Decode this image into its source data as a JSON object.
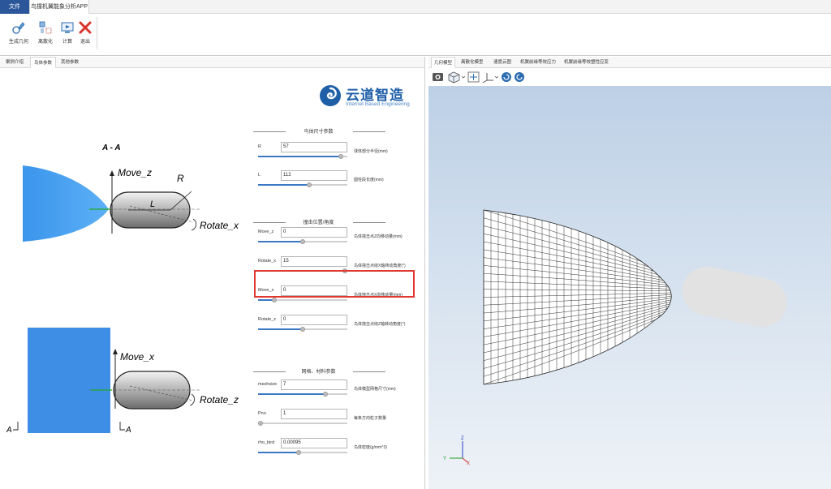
{
  "menu": {
    "file_tab": "文件",
    "app_tab": "鸟撞机翼能象分析APP"
  },
  "ribbon": {
    "buttons": [
      {
        "label": "生成几何",
        "icon": "geometry-icon"
      },
      {
        "label": "离散化",
        "icon": "mesh-icon"
      },
      {
        "label": "计算",
        "icon": "compute-icon"
      },
      {
        "label": "退出",
        "icon": "exit-icon"
      }
    ]
  },
  "left_tabs": [
    "案例介绍",
    "鸟体参数",
    "其他参数"
  ],
  "logo": {
    "brand": "云道智造",
    "sub": "Internet Based Engineering"
  },
  "diagram": {
    "section_title": "A - A",
    "move_z": "Move_z",
    "R": "R",
    "L": "L",
    "rotate_x": "Rotate_x",
    "move_x": "Move_x",
    "rotate_z": "Rotate_z",
    "a_left": "A",
    "a_right": "A"
  },
  "sections": {
    "size": "鸟体尺寸参数",
    "position": "撞击位置/角度",
    "mesh": "网格、材料参数"
  },
  "params": [
    {
      "label": "R",
      "value": "57",
      "desc": "球体部分半径(mm)",
      "fill": 0.93
    },
    {
      "label": "L",
      "value": "112",
      "desc": "圆柱段长度(mm)",
      "fill": 0.57
    },
    {
      "label": "Move_z",
      "value": "0",
      "desc": "鸟体撞击点Z向移动量(mm)",
      "fill": 0.5
    },
    {
      "label": "Rotate_x",
      "value": "15",
      "desc": "鸟体撞击点绕X轴转动角度(°)",
      "fill": 0.97
    },
    {
      "label": "Move_x",
      "value": "0",
      "desc": "鸟体撞击点X向移动量(mm)",
      "fill": 0.18
    },
    {
      "label": "Rotate_z",
      "value": "0",
      "desc": "鸟体撞击点绕Z轴转动角度(°)",
      "fill": 0.5
    },
    {
      "label": "meshsize",
      "value": "7",
      "desc": "鸟体模型网格尺寸(mm)",
      "fill": 0.75
    },
    {
      "label": "Pno",
      "value": "1",
      "desc": "每条方向粒子数量",
      "fill": 0.0
    },
    {
      "label": "rho_bird",
      "value": "0.00095",
      "desc": "鸟体密度(g/mm^3)",
      "fill": 0.45
    }
  ],
  "right_tabs": [
    "几何模型",
    "离散化模型",
    "速度云图",
    "机翼前缘等效应力",
    "机翼前缘等效塑性应变"
  ],
  "axes": {
    "z": "Z",
    "y": "Y",
    "x": "X"
  },
  "colors": {
    "accent": "#2b579a",
    "wing": "#55a9f0",
    "highlight": "#e03a30"
  }
}
